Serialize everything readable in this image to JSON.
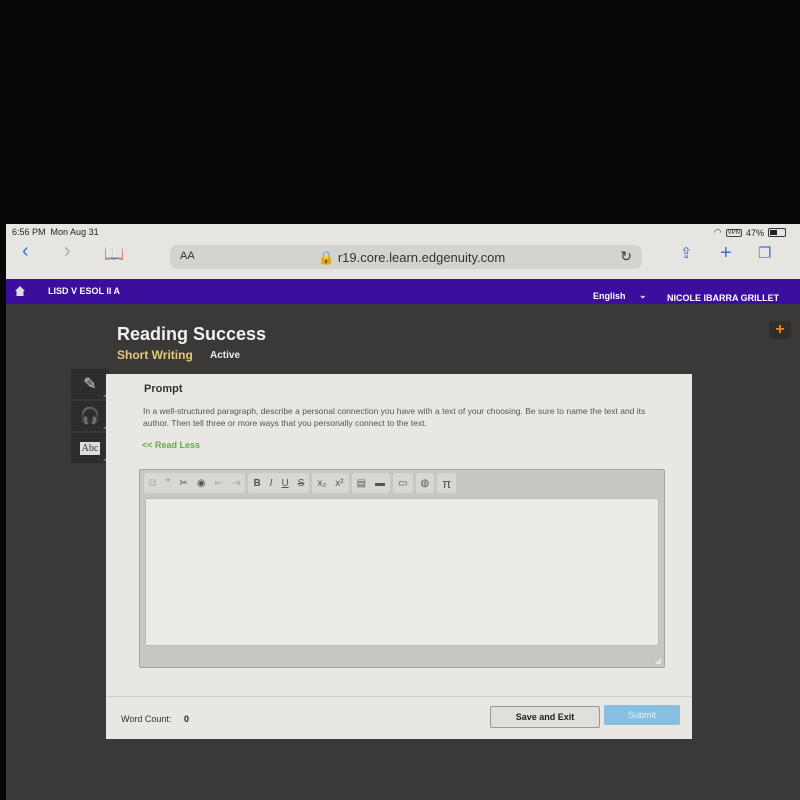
{
  "status_bar": {
    "time": "6:56 PM",
    "date": "Mon Aug 31",
    "vpn": "VPN",
    "battery": "47%",
    "battery_level": 0.47
  },
  "browser": {
    "text_size_label": "AA",
    "url": "r19.core.learn.edgenuity.com",
    "icons": [
      "back-icon",
      "forward-icon",
      "bookmarks-icon",
      "lock-icon",
      "reload-icon",
      "share-icon",
      "new-tab-icon",
      "tabs-icon"
    ]
  },
  "topnav": {
    "course": "LISD V ESOL II A",
    "language": "English",
    "user": "NICOLE IBARRA GRILLET"
  },
  "page": {
    "title": "Reading Success",
    "subtitle": "Short Writing",
    "status": "Active"
  },
  "tools": [
    "pencil-icon",
    "headphones-icon",
    "dictionary-icon"
  ],
  "prompt": {
    "heading": "Prompt",
    "text": "In a well-structured paragraph, describe a personal connection you have with a text of your choosing. Be sure to name the text and its author. Then tell three or more ways that you personally connect to the text.",
    "read_less": "<< Read Less"
  },
  "editor": {
    "toolbar": {
      "bold": "B",
      "italic": "I",
      "underline": "U",
      "strike": "S",
      "subscript": "x₂",
      "superscript": "x²",
      "pi": "π"
    },
    "value": ""
  },
  "footer": {
    "word_count_label": "Word Count:",
    "word_count": "0",
    "save_label": "Save and Exit",
    "submit_label": "Submit"
  }
}
